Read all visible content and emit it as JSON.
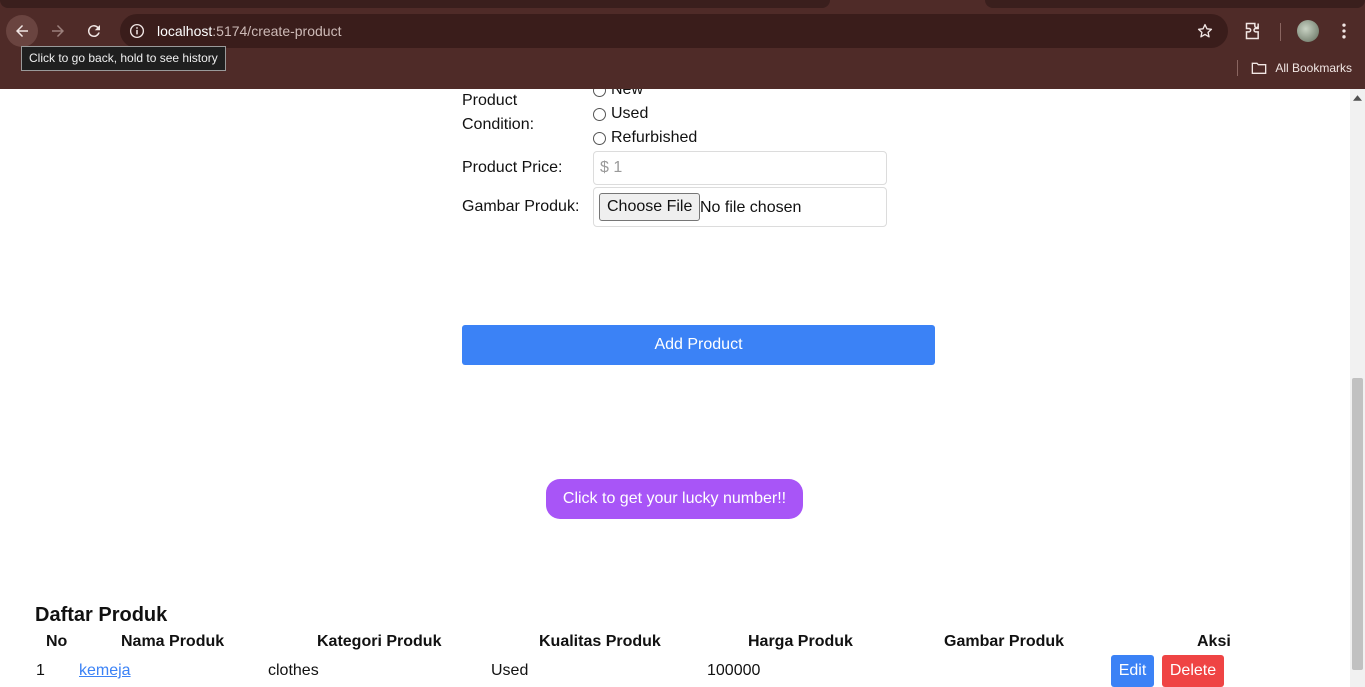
{
  "browser": {
    "url_host": "localhost",
    "url_path": ":5174/create-product",
    "tooltip": "Click to go back, hold to see history",
    "bookmarks_label": "All Bookmarks"
  },
  "form": {
    "condition_label": "Product Condition:",
    "condition_options": [
      "New",
      "Used",
      "Refurbished"
    ],
    "price_label": "Product Price:",
    "price_placeholder": "$ 1",
    "image_label": "Gambar Produk:",
    "file_button": "Choose File",
    "file_status": "No file chosen",
    "submit_label": "Add Product"
  },
  "lucky": {
    "label": "Click to get your lucky number!!"
  },
  "product_list": {
    "title": "Daftar Produk",
    "columns": [
      "No",
      "Nama Produk",
      "Kategori Produk",
      "Kualitas Produk",
      "Harga Produk",
      "Gambar Produk",
      "Aksi"
    ],
    "rows": [
      {
        "no": "1",
        "name": "kemeja",
        "category": "clothes",
        "quality": "Used",
        "price": "100000",
        "image": ""
      }
    ],
    "edit_label": "Edit",
    "delete_label": "Delete"
  },
  "colors": {
    "chrome": "#4f2b28",
    "primary": "#3b82f6",
    "lucky": "#a855f7",
    "danger": "#ef4444"
  }
}
